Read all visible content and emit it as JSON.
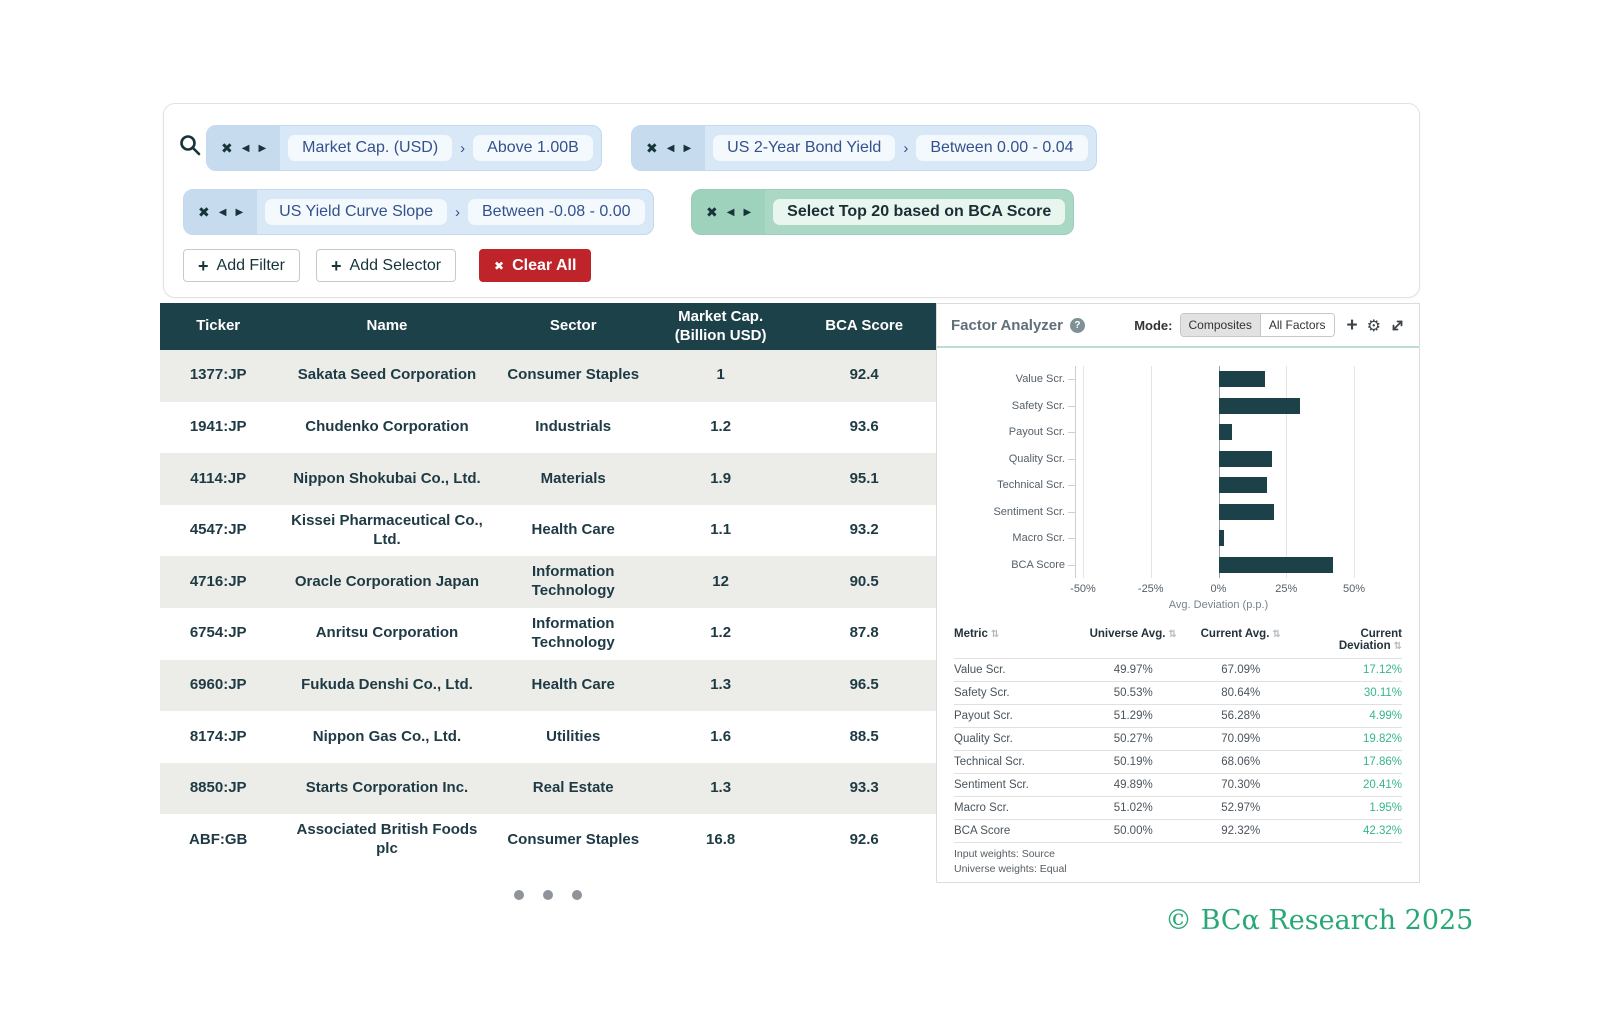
{
  "icons": {
    "close": "✖",
    "prev": "◀",
    "next": "▶",
    "chevron": "›",
    "plus": "+",
    "gear": "⚙",
    "help": "?",
    "sort": "⇅"
  },
  "filters": {
    "chips": [
      {
        "type": "filter",
        "field": "Market Cap. (USD)",
        "value": "Above 1.00B"
      },
      {
        "type": "filter",
        "field": "US 2-Year Bond Yield",
        "value": "Between 0.00 - 0.04"
      },
      {
        "type": "filter",
        "field": "US Yield Curve Slope",
        "value": "Between -0.08 - 0.00"
      },
      {
        "type": "selector",
        "label": "Select Top 20 based on BCA Score"
      }
    ],
    "buttons": {
      "add_filter": "Add Filter",
      "add_selector": "Add Selector",
      "clear_all": "Clear All"
    }
  },
  "stock_table": {
    "columns": [
      "Ticker",
      "Name",
      "Sector",
      "Market Cap. (Billion USD)",
      "BCA Score"
    ],
    "rows": [
      {
        "ticker": "1377:JP",
        "name": "Sakata Seed Corporation",
        "sector": "Consumer Staples",
        "market_cap": "1",
        "bca_score": "92.4"
      },
      {
        "ticker": "1941:JP",
        "name": "Chudenko Corporation",
        "sector": "Industrials",
        "market_cap": "1.2",
        "bca_score": "93.6"
      },
      {
        "ticker": "4114:JP",
        "name": "Nippon Shokubai Co., Ltd.",
        "sector": "Materials",
        "market_cap": "1.9",
        "bca_score": "95.1"
      },
      {
        "ticker": "4547:JP",
        "name": "Kissei Pharmaceutical Co., Ltd.",
        "sector": "Health Care",
        "market_cap": "1.1",
        "bca_score": "93.2"
      },
      {
        "ticker": "4716:JP",
        "name": "Oracle Corporation Japan",
        "sector": "Information Technology",
        "market_cap": "12",
        "bca_score": "90.5"
      },
      {
        "ticker": "6754:JP",
        "name": "Anritsu Corporation",
        "sector": "Information Technology",
        "market_cap": "1.2",
        "bca_score": "87.8"
      },
      {
        "ticker": "6960:JP",
        "name": "Fukuda Denshi Co., Ltd.",
        "sector": "Health Care",
        "market_cap": "1.3",
        "bca_score": "96.5"
      },
      {
        "ticker": "8174:JP",
        "name": "Nippon Gas Co., Ltd.",
        "sector": "Utilities",
        "market_cap": "1.6",
        "bca_score": "88.5"
      },
      {
        "ticker": "8850:JP",
        "name": "Starts Corporation Inc.",
        "sector": "Real Estate",
        "market_cap": "1.3",
        "bca_score": "93.3"
      },
      {
        "ticker": "ABF:GB",
        "name": "Associated British Foods plc",
        "sector": "Consumer Staples",
        "market_cap": "16.8",
        "bca_score": "92.6"
      }
    ],
    "pagination_dots": 3
  },
  "factor_analyzer": {
    "title": "Factor Analyzer",
    "mode_label": "Mode:",
    "modes": [
      "Composites",
      "All Factors"
    ],
    "selected_mode": "Composites",
    "chart_data": {
      "type": "bar",
      "orientation": "horizontal",
      "categories": [
        "Value Scr.",
        "Safety Scr.",
        "Payout Scr.",
        "Quality Scr.",
        "Technical Scr.",
        "Sentiment Scr.",
        "Macro Scr.",
        "BCA Score"
      ],
      "values": [
        17.12,
        30.11,
        4.99,
        19.82,
        17.86,
        20.41,
        1.95,
        42.32
      ],
      "xlabel": "Avg. Deviation (p.p.)",
      "xlim": [
        -50,
        50
      ],
      "xticks": [
        -50,
        -25,
        0,
        25,
        50
      ],
      "xtick_labels": [
        "-50%",
        "-25%",
        "0%",
        "25%",
        "50%"
      ],
      "bar_color": "#1d4149",
      "grid": true,
      "legend": false
    },
    "metrics_table": {
      "columns": [
        "Metric",
        "Universe Avg.",
        "Current Avg.",
        "Current Deviation"
      ],
      "rows": [
        {
          "metric": "Value Scr.",
          "universe_avg": "49.97%",
          "current_avg": "67.09%",
          "current_deviation": "17.12%"
        },
        {
          "metric": "Safety Scr.",
          "universe_avg": "50.53%",
          "current_avg": "80.64%",
          "current_deviation": "30.11%"
        },
        {
          "metric": "Payout Scr.",
          "universe_avg": "51.29%",
          "current_avg": "56.28%",
          "current_deviation": "4.99%"
        },
        {
          "metric": "Quality Scr.",
          "universe_avg": "50.27%",
          "current_avg": "70.09%",
          "current_deviation": "19.82%"
        },
        {
          "metric": "Technical Scr.",
          "universe_avg": "50.19%",
          "current_avg": "68.06%",
          "current_deviation": "17.86%"
        },
        {
          "metric": "Sentiment Scr.",
          "universe_avg": "49.89%",
          "current_avg": "70.30%",
          "current_deviation": "20.41%"
        },
        {
          "metric": "Macro Scr.",
          "universe_avg": "51.02%",
          "current_avg": "52.97%",
          "current_deviation": "1.95%"
        },
        {
          "metric": "BCA Score",
          "universe_avg": "50.00%",
          "current_avg": "92.32%",
          "current_deviation": "42.32%"
        }
      ]
    },
    "footnotes": [
      "Input weights: Source",
      "Universe weights: Equal"
    ]
  },
  "footer": {
    "copyright": "© BCα Research 2025"
  },
  "colors": {
    "table_header": "#1d4149",
    "row_alt": "#ecede8",
    "chip_blue_bg": "#d9e8f7",
    "chip_green_bg": "#abd8c4",
    "clear_all_red": "#c0242b",
    "deviation_green": "#35b786",
    "brand_green": "#29a877",
    "bar_color": "#1d4149"
  }
}
